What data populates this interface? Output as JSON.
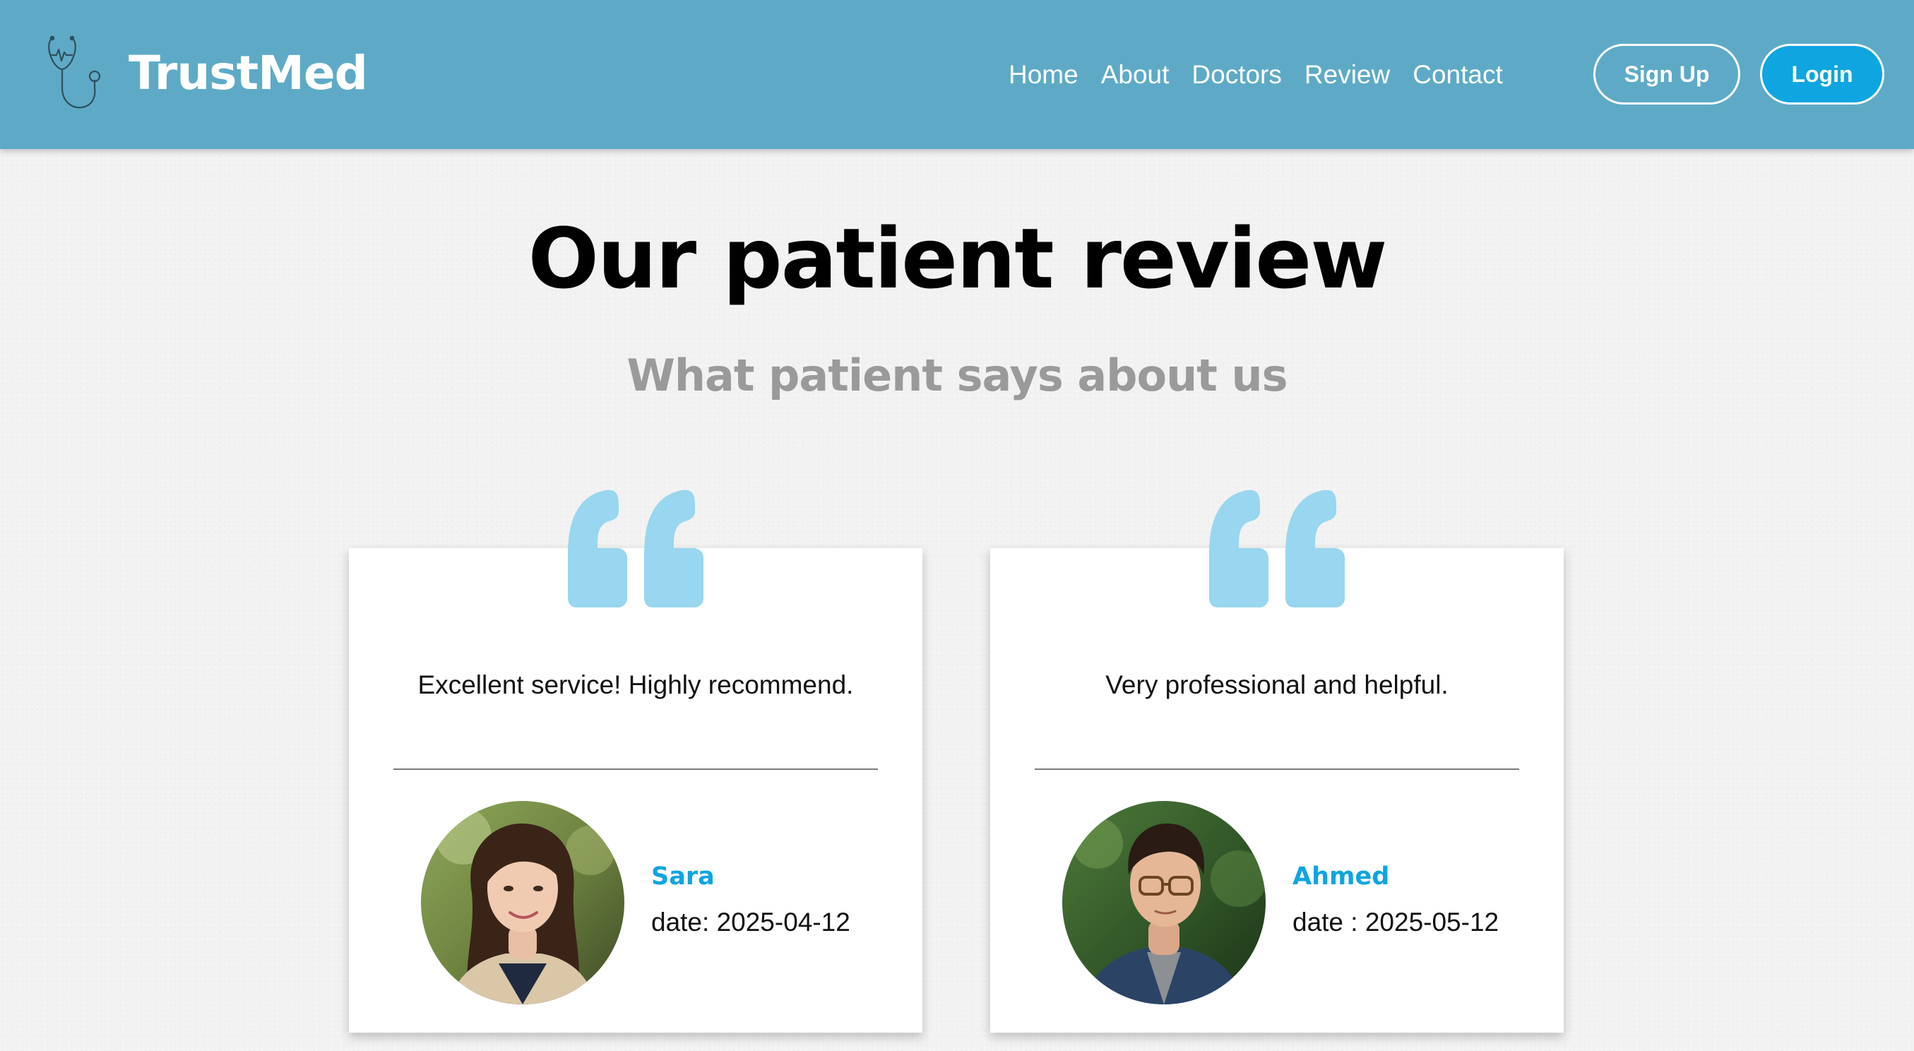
{
  "header": {
    "brand": "TrustMed",
    "logo_icon": "stethoscope-icon",
    "nav": [
      "Home",
      "About",
      "Doctors",
      "Review",
      "Contact"
    ],
    "signup_label": "Sign Up",
    "login_label": "Login"
  },
  "main": {
    "title": "Our patient review",
    "subtitle": "What patient says about us"
  },
  "reviews": [
    {
      "text": "Excellent service! Highly recommend.",
      "name": "Sara",
      "date": "date: 2025-04-12",
      "avatar_icon": "reviewer-photo"
    },
    {
      "text": "Very professional and helpful.",
      "name": "Ahmed",
      "date": "date : 2025-05-12",
      "avatar_icon": "reviewer-photo"
    }
  ],
  "colors": {
    "header_bg": "#5eaac6",
    "accent": "#0ea5e0",
    "quote": "#99d6ef",
    "subtitle": "#9a9a9a"
  }
}
